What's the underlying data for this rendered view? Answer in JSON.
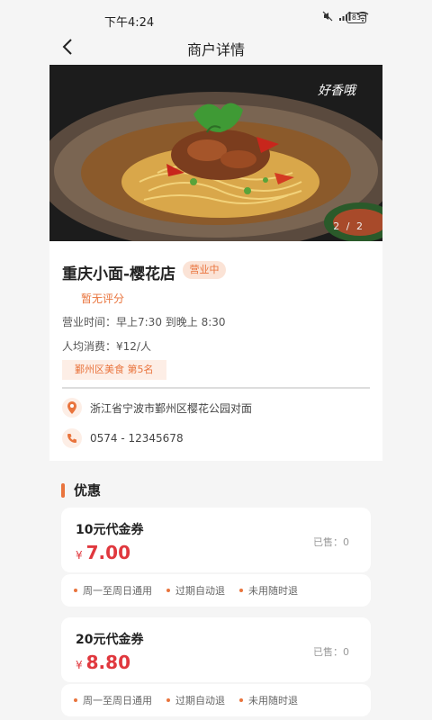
{
  "status_bar": {
    "time": "下午4:24",
    "battery": "83"
  },
  "nav": {
    "title": "商户详情"
  },
  "banner": {
    "counter": "2 / 2",
    "tag": "好香哦"
  },
  "shop": {
    "name": "重庆小面-樱花店",
    "status": "营业中",
    "rating": "暂无评分",
    "hours": "营业时间：早上7:30 到晚上 8:30",
    "avg_cost": "人均消费：¥12/人",
    "rank": "鄞州区美食  第5名",
    "address": "浙江省宁波市鄞州区樱花公园对面",
    "phone": "0574 - 12345678"
  },
  "section": {
    "title": "优惠"
  },
  "coupons": [
    {
      "name": "10元代金券",
      "currency": "¥",
      "price": "7.00",
      "sold": "已售：0",
      "perks": [
        "周一至周日通用",
        "过期自动退",
        "未用随时退"
      ]
    },
    {
      "name": "20元代金券",
      "currency": "¥",
      "price": "8.80",
      "sold": "已售：0",
      "perks": [
        "周一至周日通用",
        "过期自动退",
        "未用随时退"
      ]
    }
  ],
  "colors": {
    "accent": "#e9743d",
    "price": "#e0383e"
  }
}
